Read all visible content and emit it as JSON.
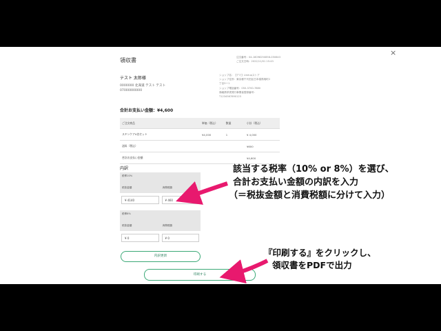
{
  "modal": {
    "title": "領収書",
    "close": "×",
    "meta": [
      "注文番号：04-18098250856-050643",
      "ご注文日時：2022/11/01 15:43"
    ],
    "shop_lines": [
      "ショップ名：【アミ】Lineupストア",
      "ショップ住所：東京都千代田区日本橋馬喰町2",
      "丁目3ー1",
      "ショップ電話番号：050-3700-7880",
      "適格請求書発行事業者登録番号：",
      "T1234567890123"
    ],
    "customer": {
      "name": "テスト 太郎様",
      "address": "0000000 北海道 テスト テスト",
      "phone": "07000000000"
    },
    "total": "合計お支払い金額：¥4,600",
    "table": {
      "headers": [
        "ご注文商品",
        "単価（税込）",
        "数量",
        "小計（税込）"
      ],
      "rows": [
        [
          "スキンケアA名セット",
          "¥4,000",
          "1",
          "¥ 4,000"
        ],
        [
          "送料（税込）",
          "",
          "",
          "¥600"
        ],
        [
          "合計お支払い金額",
          "",
          "",
          "¥4,600"
        ]
      ]
    },
    "breakdown_title": "内訳",
    "tax10": {
      "header": "税率10%",
      "col1": "税抜金額",
      "col2": "消費税額",
      "val1": "¥ 4140",
      "val2": "¥ 460"
    },
    "tax8": {
      "header": "税率8%",
      "col1": "税抜金額",
      "col2": "消費税額",
      "val1": "¥ 0",
      "val2": "¥ 0"
    },
    "update_button": "内訳更新",
    "print_button": "印刷する"
  },
  "annotations": {
    "a1": [
      "該当する税率（10% or 8%）を選び、",
      "合計お支払い金額の内訳を入力",
      "（＝税抜金額と消費税額に分けて入力）"
    ],
    "a2": [
      "『印刷する』をクリックし、",
      "領収書をPDFで出力"
    ]
  },
  "colors": {
    "arrow": "#e8196e",
    "accent": "#3aa876"
  }
}
